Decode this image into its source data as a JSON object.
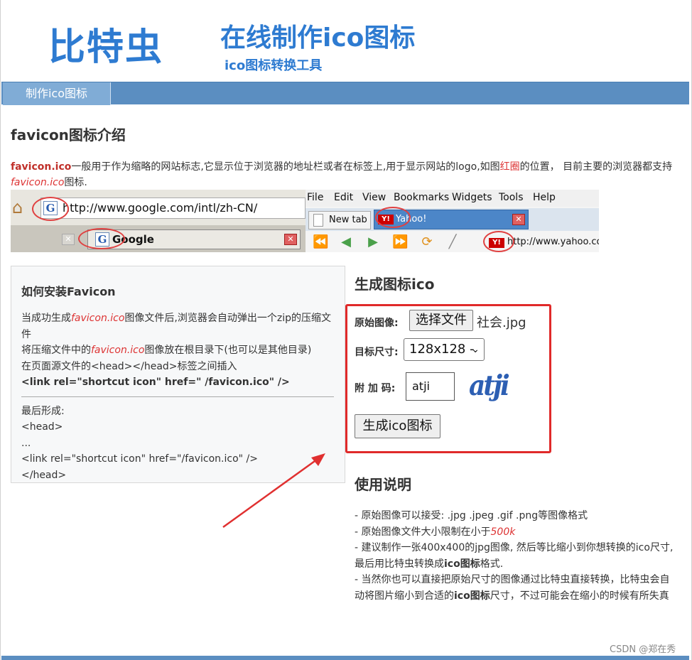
{
  "header": {
    "logo": "比特虫",
    "title": "在线制作ico图标",
    "subtitle": "ico图标转换工具"
  },
  "nav": {
    "items": [
      "制作ico图标"
    ]
  },
  "intro": {
    "heading": "favicon图标介绍",
    "term": "favicon.ico",
    "text1": "一般用于作为缩略的网站标志,它显示位于浏览器的地址栏或者在标签上,用于显示网站的logo,如图",
    "highlight": "红圈",
    "text2": "的位置，  目前主要的浏览器都支持",
    "term2": "favicon.ico",
    "text3": "图标."
  },
  "browser_image": {
    "ff_url": "http://www.google.com/intl/zh-CN/",
    "ff_tab": "Google",
    "ie_menu": [
      "File",
      "Edit",
      "View",
      "Bookmarks",
      "Widgets",
      "Tools",
      "Help"
    ],
    "ie_tab1": "New tab",
    "ie_tab2": "Yahoo!",
    "ie_url": "http://www.yahoo.com"
  },
  "install": {
    "heading": "如何安装Favicon",
    "line1a": "当成功生成",
    "line1term": "favicon.ico",
    "line1b": "图像文件后,浏览器会自动弹出一个zip的压缩文件",
    "line2a": "将压缩文件中的",
    "line2term": "favicon.ico",
    "line2b": "图像放在根目录下(也可以是其他目录)",
    "line3": "在页面源文件的<head></head>标签之间插入",
    "code": "<link rel=\"shortcut icon\" href=\" /favicon.ico\" />",
    "final_label": "最后形成:",
    "final1": "<head>",
    "final2": "...",
    "final3": "<link rel=\"shortcut icon\" href=\"/favicon.ico\" />",
    "final4": "</head>"
  },
  "generator": {
    "heading": "生成图标ico",
    "source_label": "原始图像:",
    "file_button": "选择文件",
    "file_name": "社会.jpg",
    "size_label": "目标尺寸:",
    "size_value": "128x128 -",
    "code_label": "附 加 码:",
    "code_value": "atji",
    "captcha": "atji",
    "submit": "生成ico图标"
  },
  "usage": {
    "heading": "使用说明",
    "l1": "- 原始图像可以接受: .jpg .jpeg .gif .png等图像格式",
    "l2a": "- 原始图像文件大小限制在小于",
    "l2b": "500k",
    "l3a": "- 建议制作一张400x400的jpg图像, 然后等比缩小到你想转换的ico尺寸,最后用比特虫转换成",
    "l3b": "ico图标",
    "l3c": "格式.",
    "l4a": "- 当然你也可以直接把原始尺寸的图像通过比特虫直接转换，比特虫会自动将图片缩小到合适的",
    "l4b": "ico图标",
    "l4c": "尺寸，不过可能会在缩小的时候有所失真"
  },
  "watermark": "CSDN @郑在秀"
}
